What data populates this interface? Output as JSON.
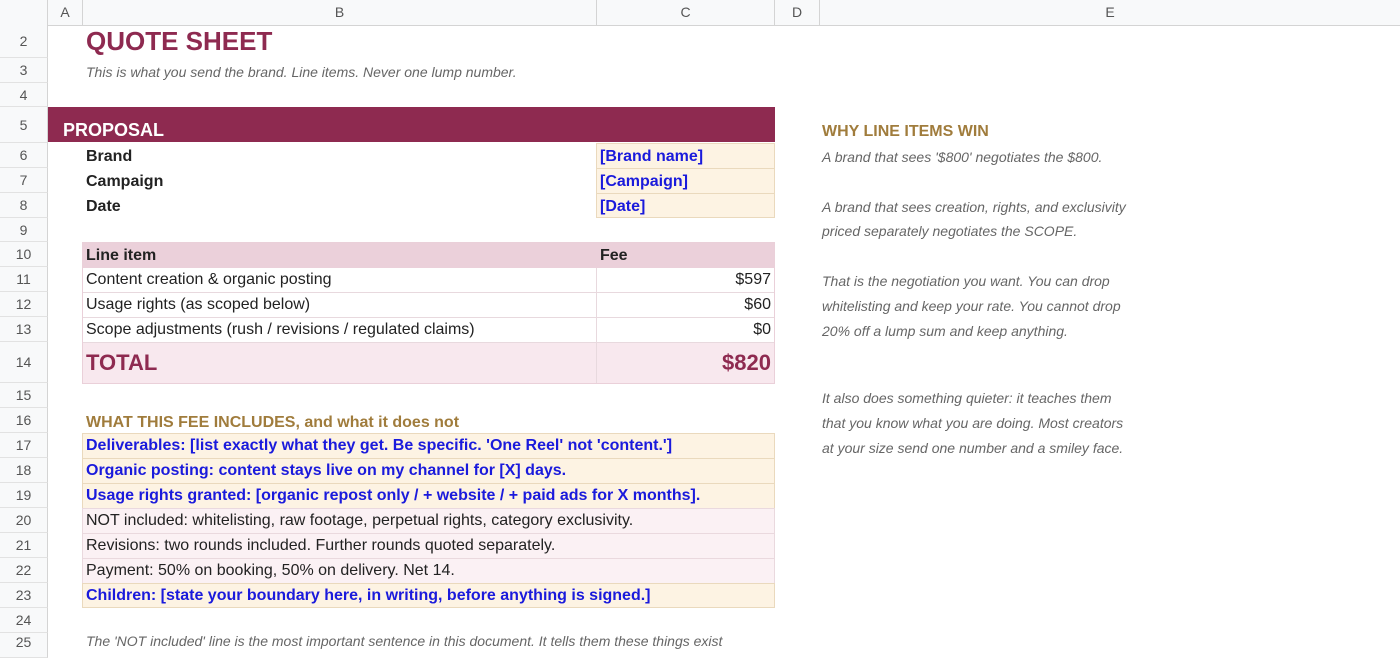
{
  "columns": [
    "A",
    "B",
    "C",
    "D",
    "E"
  ],
  "rows": [
    "2",
    "3",
    "4",
    "5",
    "6",
    "7",
    "8",
    "9",
    "10",
    "11",
    "12",
    "13",
    "14",
    "15",
    "16",
    "17",
    "18",
    "19",
    "20",
    "21",
    "22",
    "23",
    "24",
    "25"
  ],
  "title": "QUOTE SHEET",
  "subtitle": "This is what you send the brand. Line items. Never one lump number.",
  "proposal": {
    "header": "PROPOSAL",
    "fields": [
      {
        "label": "Brand",
        "value": "[Brand name]"
      },
      {
        "label": "Campaign",
        "value": "[Campaign]"
      },
      {
        "label": "Date",
        "value": "[Date]"
      }
    ]
  },
  "line_items": {
    "header_item": "Line item",
    "header_fee": "Fee",
    "rows": [
      {
        "item": "Content creation & organic posting",
        "fee": "$597"
      },
      {
        "item": "Usage rights (as scoped below)",
        "fee": "$60"
      },
      {
        "item": "Scope adjustments (rush / revisions / regulated claims)",
        "fee": "$0"
      }
    ],
    "total_label": "TOTAL",
    "total_value": "$820"
  },
  "includes": {
    "heading": "WHAT THIS FEE INCLUDES, and what it does not",
    "items": [
      {
        "text": "Deliverables: [list exactly what they get. Be specific. 'One Reel' not 'content.']",
        "style": "blue"
      },
      {
        "text": "Organic posting: content stays live on my channel for [X] days.",
        "style": "blue"
      },
      {
        "text": "Usage rights granted: [organic repost only / + website / + paid ads for X months].",
        "style": "blue"
      },
      {
        "text": "NOT included: whitelisting, raw footage, perpetual rights, category exclusivity.",
        "style": "plain"
      },
      {
        "text": "Revisions: two rounds included. Further rounds quoted separately.",
        "style": "plain"
      },
      {
        "text": "Payment: 50% on booking, 50% on delivery. Net 14.",
        "style": "plain"
      },
      {
        "text": "Children: [state your boundary here, in writing, before anything is signed.]",
        "style": "blue"
      }
    ],
    "footnote": "The 'NOT included' line is the most important sentence in this document. It tells them these things exist"
  },
  "sidebar": {
    "heading": "WHY LINE ITEMS WIN",
    "lines": [
      "A brand that sees '$800' negotiates the $800.",
      "A brand that sees creation, rights, and exclusivity",
      "priced separately negotiates the SCOPE.",
      "That is the negotiation you want. You can drop",
      "whitelisting and keep your rate. You cannot drop",
      "20% off a lump sum and keep anything.",
      "It also does something quieter: it teaches them",
      "that you know what you are doing. Most creators",
      "at your size send one number and a smiley face."
    ]
  },
  "colors": {
    "brand": "#8e2a50",
    "gold": "#a07c3c",
    "input_blue": "#1a1adc",
    "input_fill": "#fdf3e3",
    "table_header": "#ebd0da"
  }
}
